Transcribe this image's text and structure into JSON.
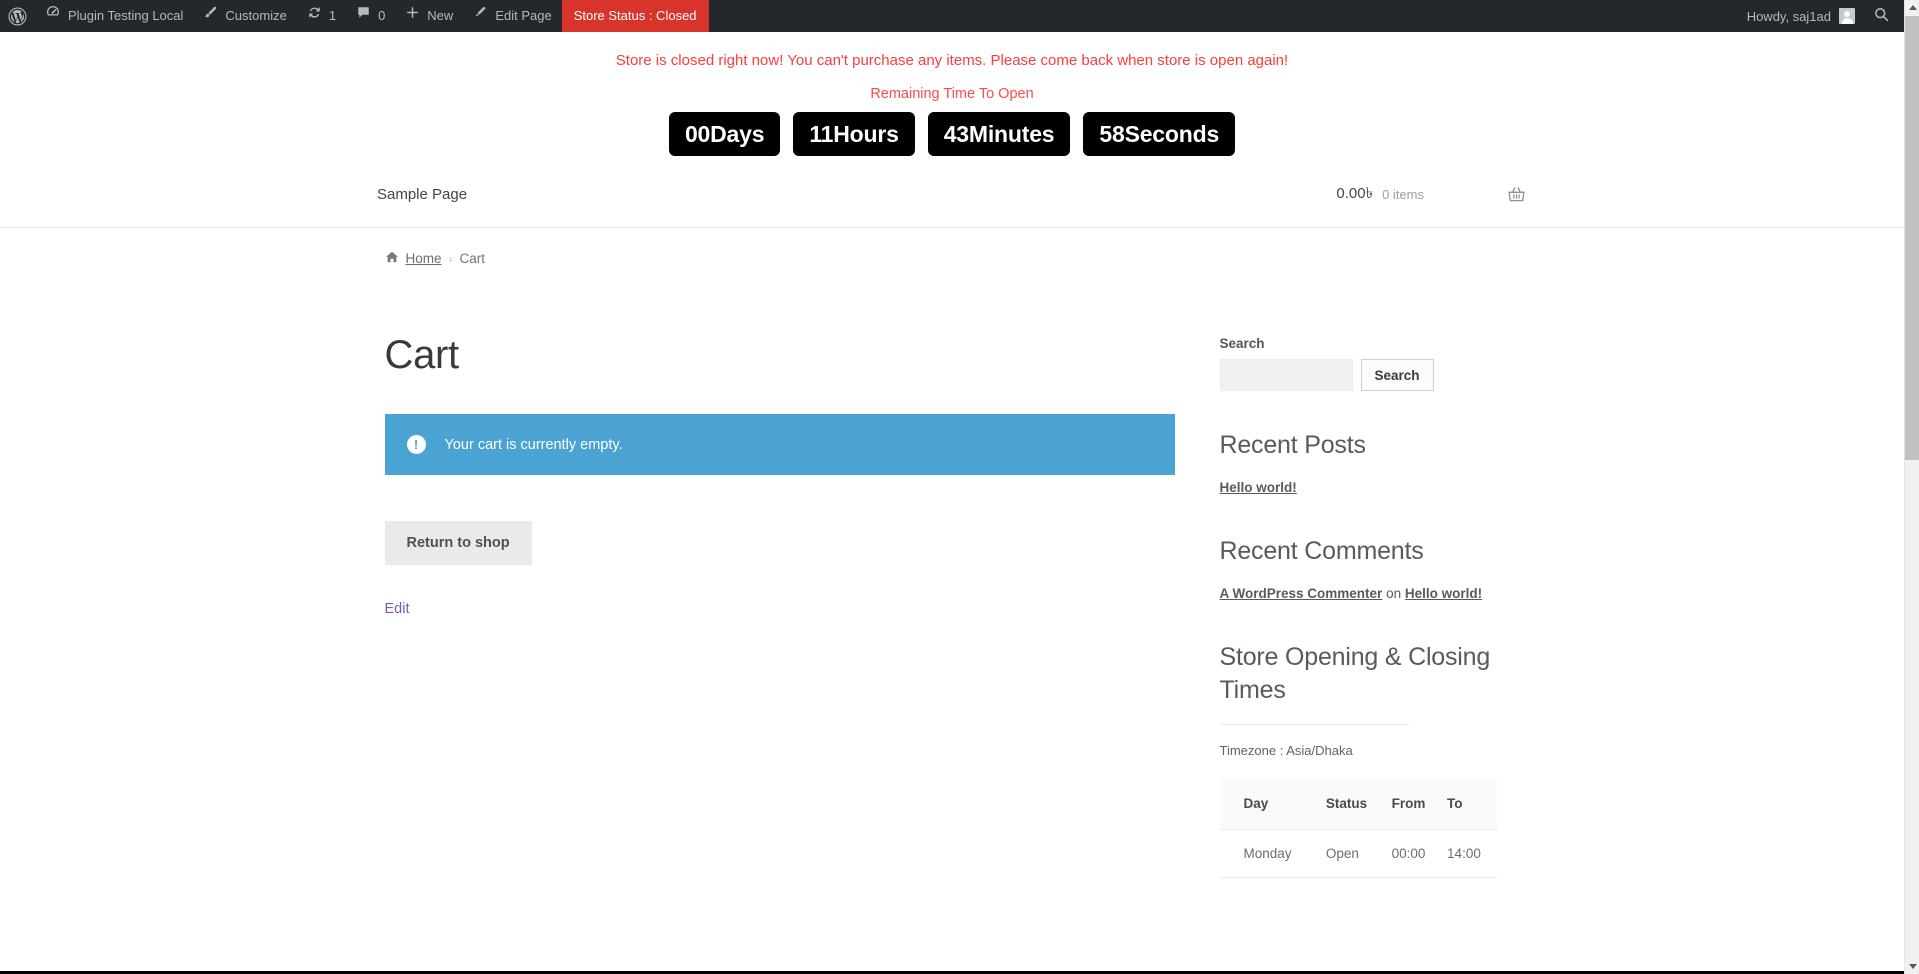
{
  "adminbar": {
    "logo_icon": "wordpress-logo-icon",
    "items": [
      {
        "label": "Plugin Testing Local",
        "icon": "dashboard-speedometer-icon"
      },
      {
        "label": "Customize",
        "icon": "paintbrush-icon"
      },
      {
        "label": "1",
        "icon": "updates-refresh-icon"
      },
      {
        "label": "0",
        "icon": "comment-bubble-icon"
      },
      {
        "label": "New",
        "icon": "plus-icon"
      },
      {
        "label": "Edit Page",
        "icon": "pencil-icon"
      }
    ],
    "store_status": "Store Status : Closed",
    "store_status_color": "#d9342b",
    "howdy": "Howdy, saj1ad",
    "avatar_icon": "user-avatar-icon",
    "search_icon": "search-icon",
    "background_color": "#23282d"
  },
  "store_closed": {
    "message": "Store is closed right now! You can't purchase any items. Please come back when store is open again!",
    "message_color": "#ff3b3b",
    "remaining_label": "Remaining Time To Open",
    "countdown": [
      {
        "value": "00",
        "unit": "Days",
        "text": "00Days"
      },
      {
        "value": "11",
        "unit": "Hours",
        "text": "11Hours"
      },
      {
        "value": "43",
        "unit": "Minutes",
        "text": "43Minutes"
      },
      {
        "value": "58",
        "unit": "Seconds",
        "text": "58Seconds"
      }
    ]
  },
  "header": {
    "nav": {
      "label": "Sample Page"
    },
    "cart": {
      "amount": "0.00৳",
      "items": "0 items",
      "basket_icon": "shopping-basket-icon"
    }
  },
  "breadcrumb": {
    "home_icon": "home-icon",
    "home": "Home",
    "separator": "›",
    "current": "Cart"
  },
  "main": {
    "title": "Cart",
    "notice": {
      "icon": "info-exclamation-icon",
      "text": "Your cart is currently empty.",
      "background_color": "#4ba3d3"
    },
    "return_button": "Return to shop",
    "edit_link": "Edit",
    "edit_link_color": "#7d5ba6"
  },
  "sidebar": {
    "search": {
      "label": "Search",
      "value": "",
      "placeholder": "",
      "button": "Search"
    },
    "recent_posts": {
      "title": "Recent Posts",
      "items": [
        {
          "label": "Hello world!"
        }
      ]
    },
    "recent_comments": {
      "title": "Recent Comments",
      "items": [
        {
          "author": "A WordPress Commenter",
          "on": "on",
          "post": "Hello world!"
        }
      ]
    },
    "store_hours": {
      "title": "Store Opening & Closing Times",
      "timezone": "Timezone : Asia/Dhaka",
      "columns": [
        "Day",
        "Status",
        "From",
        "To"
      ],
      "rows": [
        {
          "day": "Monday",
          "status": "Open",
          "from": "00:00",
          "to": "14:00"
        }
      ]
    }
  }
}
